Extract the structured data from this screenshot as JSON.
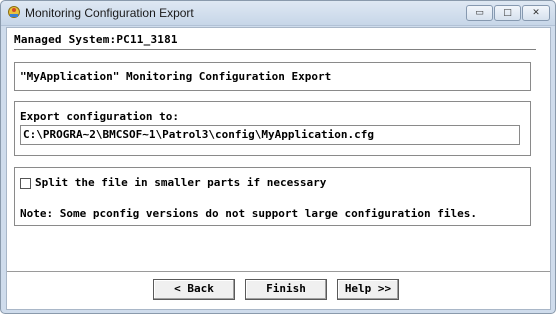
{
  "window": {
    "title": "Monitoring Configuration Export",
    "minimize_glyph": "▭",
    "maximize_glyph": "□",
    "close_glyph": "✕"
  },
  "header": {
    "managed_system": "Managed System:PC11_3181"
  },
  "section_title": "\"MyApplication\" Monitoring Configuration Export",
  "export": {
    "label": "Export configuration to:",
    "path_value": "C:\\PROGRA~2\\BMCSOF~1\\Patrol3\\config\\MyApplication.cfg"
  },
  "split": {
    "checkbox_label": "Split the file in smaller parts if necessary",
    "checked": false,
    "note": "Note: Some pconfig versions do not support large configuration files."
  },
  "buttons": {
    "back": "< Back",
    "finish": "Finish",
    "help": "Help >>"
  },
  "icons": {
    "app": "app-icon",
    "minimize": "minimize-icon",
    "maximize": "maximize-icon",
    "close": "close-icon"
  }
}
